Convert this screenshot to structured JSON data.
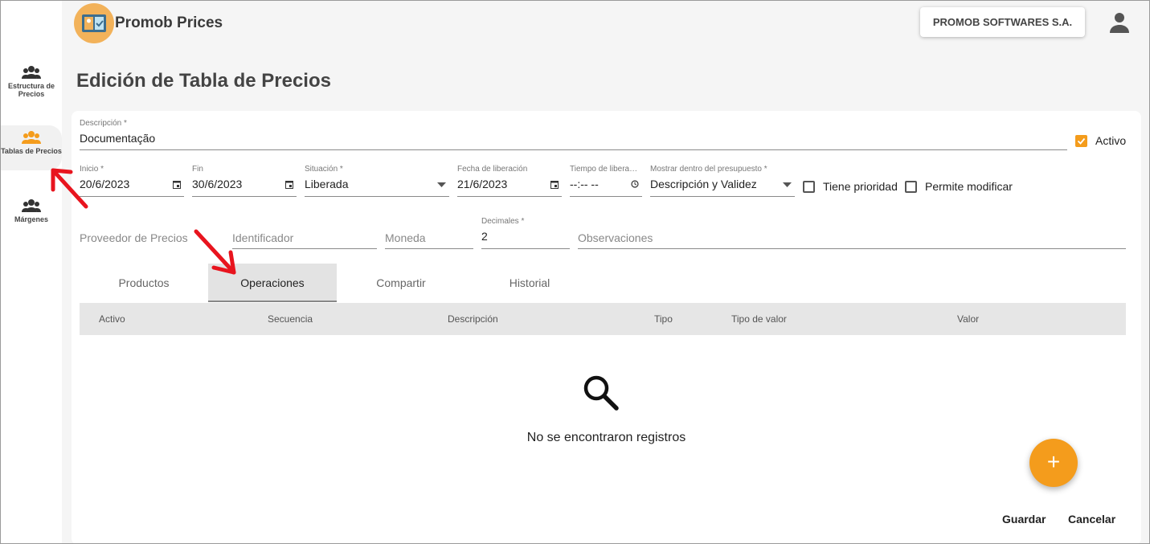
{
  "app": {
    "title": "Promob Prices",
    "company": "PROMOB SOFTWARES S.A.",
    "page_title": "Edición de Tabla de Precios"
  },
  "sidebar": {
    "items": [
      {
        "label": "Estructura de Precios",
        "icon": "group-icon",
        "active": false
      },
      {
        "label": "Tablas de Precios",
        "icon": "group-icon",
        "active": true
      },
      {
        "label": "Márgenes",
        "icon": "group-icon",
        "active": false
      }
    ]
  },
  "form": {
    "descripcion": {
      "label": "Descripción *",
      "value": "Documentação"
    },
    "activo": {
      "label": "Activo",
      "checked": true
    },
    "inicio": {
      "label": "Inicio *",
      "value": "20/6/2023"
    },
    "fin": {
      "label": "Fin",
      "value": "30/6/2023"
    },
    "situacion": {
      "label": "Situación *",
      "value": "Liberada"
    },
    "fecha_liberacion": {
      "label": "Fecha de liberación",
      "value": "21/6/2023"
    },
    "tiempo_liberacion": {
      "label": "Tiempo de libera…",
      "value": "--:-- --"
    },
    "mostrar": {
      "label": "Mostrar dentro del presupuesto *",
      "value": "Descripción y Validez"
    },
    "tiene_prioridad": {
      "label": "Tiene prioridad",
      "checked": false
    },
    "permite_modificar": {
      "label": "Permite modificar",
      "checked": false
    },
    "proveedor": {
      "placeholder": "Proveedor de Precios"
    },
    "identificador": {
      "placeholder": "Identificador"
    },
    "moneda": {
      "placeholder": "Moneda"
    },
    "decimales": {
      "label": "Decimales *",
      "value": "2"
    },
    "observaciones": {
      "placeholder": "Observaciones"
    }
  },
  "tabs": [
    {
      "label": "Productos",
      "active": false
    },
    {
      "label": "Operaciones",
      "active": true
    },
    {
      "label": "Compartir",
      "active": false
    },
    {
      "label": "Historial",
      "active": false
    }
  ],
  "table": {
    "columns": [
      "Activo",
      "Secuencia",
      "Descripción",
      "Tipo",
      "Tipo de valor",
      "Valor"
    ],
    "empty_text": "No se encontraron registros"
  },
  "fab": {
    "label": "+"
  },
  "actions": {
    "save": "Guardar",
    "cancel": "Cancelar"
  },
  "colors": {
    "accent": "#f49c1c",
    "annotation": "#e8141e"
  }
}
